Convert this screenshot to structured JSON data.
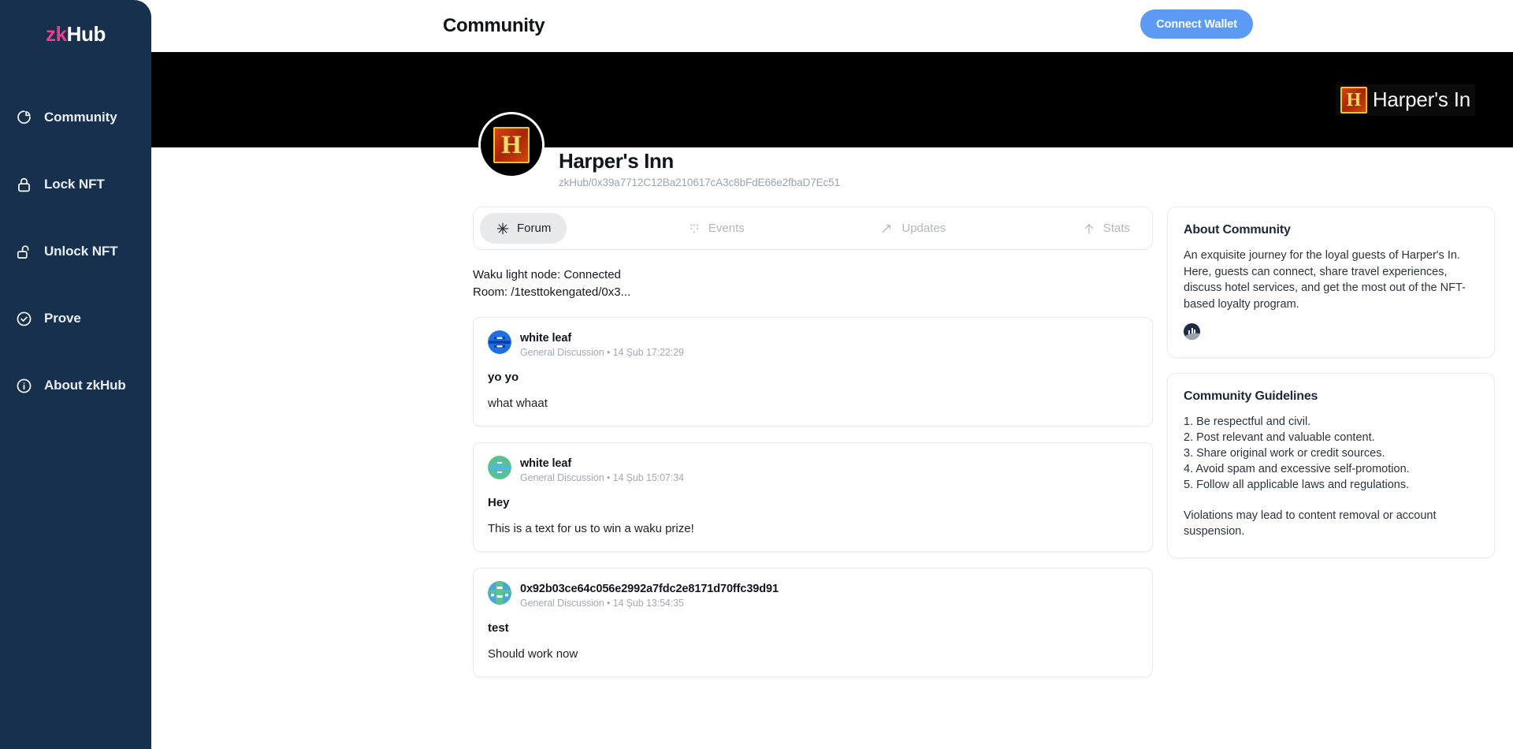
{
  "sidebar": {
    "brand_zk": "zk",
    "brand_hub": "Hub",
    "items": [
      {
        "label": "Community",
        "icon": "pie-chart-icon"
      },
      {
        "label": "Lock NFT",
        "icon": "lock-icon"
      },
      {
        "label": "Unlock NFT",
        "icon": "unlock-icon"
      },
      {
        "label": "Prove",
        "icon": "check-circle-icon"
      },
      {
        "label": "About zkHub",
        "icon": "info-circle-icon"
      }
    ]
  },
  "topbar": {
    "title": "Community",
    "connect_wallet_label": "Connect Wallet"
  },
  "banner": {
    "brand_letter": "H",
    "brand_name": "Harper's In"
  },
  "profile": {
    "avatar_letter": "H",
    "name": "Harper's Inn",
    "address": "zkHub/0x39a7712C12Ba210617cA3c8bFdE66e2fbaD7Ec51"
  },
  "tabs": [
    {
      "label": "Forum",
      "icon": "sparkle-icon",
      "active": true
    },
    {
      "label": "Events",
      "icon": "dots-grid-icon",
      "active": false
    },
    {
      "label": "Updates",
      "icon": "trending-up-icon",
      "active": false
    },
    {
      "label": "Stats",
      "icon": "arrow-up-icon",
      "active": false
    }
  ],
  "status": {
    "node": "Waku light node: Connected",
    "room": "Room: /1testtokengated/0x3..."
  },
  "messages": [
    {
      "author": "white leaf",
      "meta": "General Discussion • 14 Şub 17:22:29",
      "title": "yo yo",
      "body": "what whaat",
      "avatar_color": "#1f6fe0"
    },
    {
      "author": "white leaf",
      "meta": "General Discussion • 14 Şub 15:07:34",
      "title": "Hey",
      "body": "This is a text for us to win a waku prize!",
      "avatar_color": "#57c28d"
    },
    {
      "author": "0x92b03ce64c056e2992a7fdc2e8171d70ffc39d91",
      "meta": "General Discussion • 14 Şub 13:54:35",
      "title": "test",
      "body": "Should work now",
      "avatar_color": "#4aa8d8"
    }
  ],
  "about_panel": {
    "title": "About Community",
    "body": "An exquisite journey for the loyal guests of Harper's In. Here, guests can connect, share travel experiences, discuss hotel services, and get the most out of the NFT-based loyalty program."
  },
  "guidelines_panel": {
    "title": "Community Guidelines",
    "items": [
      "1. Be respectful and civil.",
      "2. Post relevant and valuable content.",
      "3. Share original work or credit sources.",
      "4. Avoid spam and excessive self-promotion.",
      "5. Follow all applicable laws and regulations."
    ],
    "note": "Violations may lead to content removal or account suspension."
  },
  "colors": {
    "sidebar_bg": "#17304d",
    "accent_pink": "#ec3c8c",
    "wallet_blue": "#5b9bf5",
    "banner_black": "#000000"
  }
}
